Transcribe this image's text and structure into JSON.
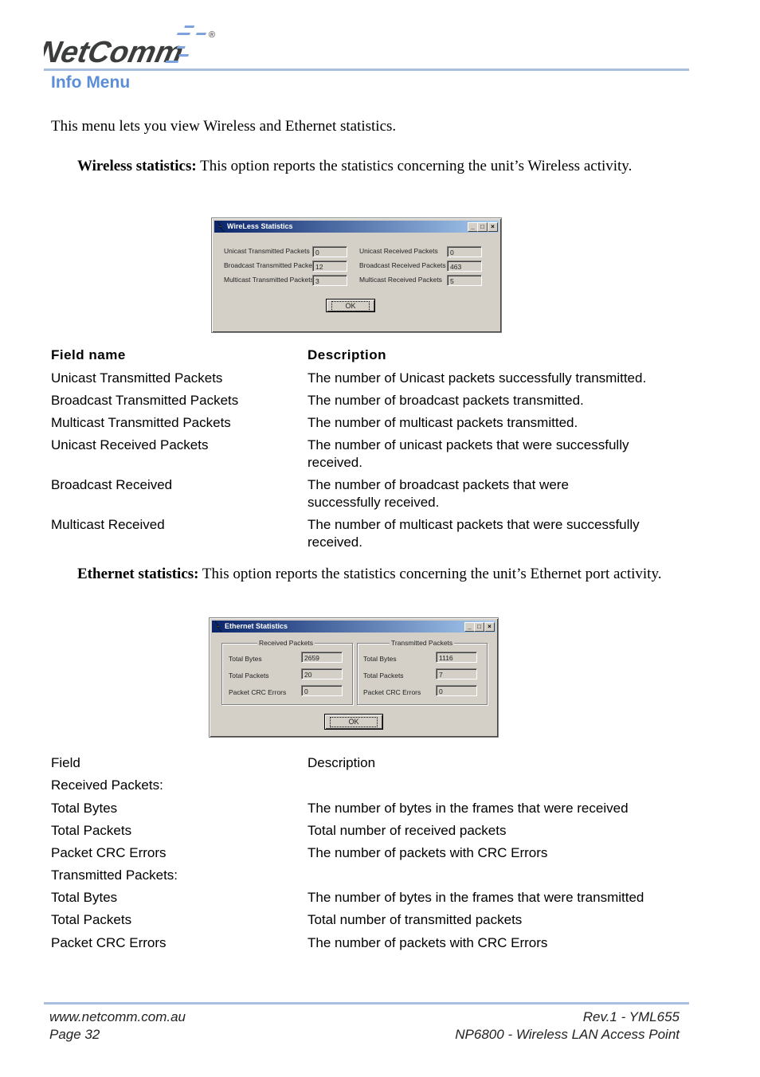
{
  "header": {
    "logo_text": "NetComm",
    "trademark": "®",
    "section_title": "Info Menu"
  },
  "intro": "This menu lets you view Wireless and Ethernet statistics.",
  "wireless": {
    "lead_bold": "Wireless statistics:",
    "lead_text": " This option reports the statistics concerning the unit’s Wireless activity.",
    "dialog": {
      "title": "WireLess Statistics",
      "fields": [
        {
          "label": "Unicast Transmitted Packets",
          "value": "0"
        },
        {
          "label": "Broadcast Transmitted Packets",
          "value": "12"
        },
        {
          "label": "Multicast Transmitted Packets",
          "value": "3"
        },
        {
          "label": "Unicast Received Packets",
          "value": "0"
        },
        {
          "label": "Broadcast Received Packets",
          "value": "463"
        },
        {
          "label": "Multicast Received Packets",
          "value": "5"
        }
      ],
      "ok_label": "OK"
    },
    "table": {
      "header": {
        "field": "Field name",
        "description": "Description"
      },
      "rows": [
        {
          "field": "Unicast Transmitted Packets",
          "description": "The number of Unicast packets successfully transmitted."
        },
        {
          "field": "Broadcast Transmitted Packets",
          "description": "The number of broadcast packets transmitted."
        },
        {
          "field": "Multicast Transmitted Packets",
          "description": "The number of multicast packets transmitted."
        },
        {
          "field": "Unicast Received Packets",
          "description": "The number of unicast packets that were successfully received."
        },
        {
          "field": "Broadcast Received",
          "description": "The number of broadcast packets that were successfully received."
        },
        {
          "field": "Multicast Received",
          "description": "The number of multicast packets that were successfully received."
        }
      ]
    }
  },
  "ethernet": {
    "lead_bold": "Ethernet statistics:",
    "lead_text": " This option reports the statistics concerning the unit’s Ethernet port activity.",
    "dialog": {
      "title": "Ethernet Statistics",
      "received_group": "Received Packets",
      "transmitted_group": "Transmitted Packets",
      "received": [
        {
          "label": "Total Bytes",
          "value": "2659"
        },
        {
          "label": "Total Packets",
          "value": "20"
        },
        {
          "label": "Packet CRC Errors",
          "value": "0"
        }
      ],
      "transmitted": [
        {
          "label": "Total Bytes",
          "value": "1116"
        },
        {
          "label": "Total Packets",
          "value": "7"
        },
        {
          "label": "Packet CRC Errors",
          "value": "0"
        }
      ],
      "ok_label": "OK"
    },
    "table": {
      "header": {
        "field": "Field",
        "description": "Description"
      },
      "rows": [
        {
          "field": "Received Packets:",
          "description": ""
        },
        {
          "field": "Total Bytes",
          "description": "The number of bytes in the frames that were received"
        },
        {
          "field": "Total Packets",
          "description": "Total number of received packets"
        },
        {
          "field": "Packet CRC Errors",
          "description": "The number of packets with CRC Errors"
        },
        {
          "field": "Transmitted Packets:",
          "description": ""
        },
        {
          "field": "Total Bytes",
          "description": "The number of bytes in the frames that were transmitted"
        },
        {
          "field": "Total Packets",
          "description": "Total number of transmitted packets"
        },
        {
          "field": "Packet CRC Errors",
          "description": "The number of packets with CRC Errors"
        }
      ]
    }
  },
  "footer": {
    "website": "www.netcomm.com.au",
    "page": "Page 32",
    "revision": "Rev.1 - YML655",
    "product": "NP6800 - Wireless LAN Access Point"
  }
}
